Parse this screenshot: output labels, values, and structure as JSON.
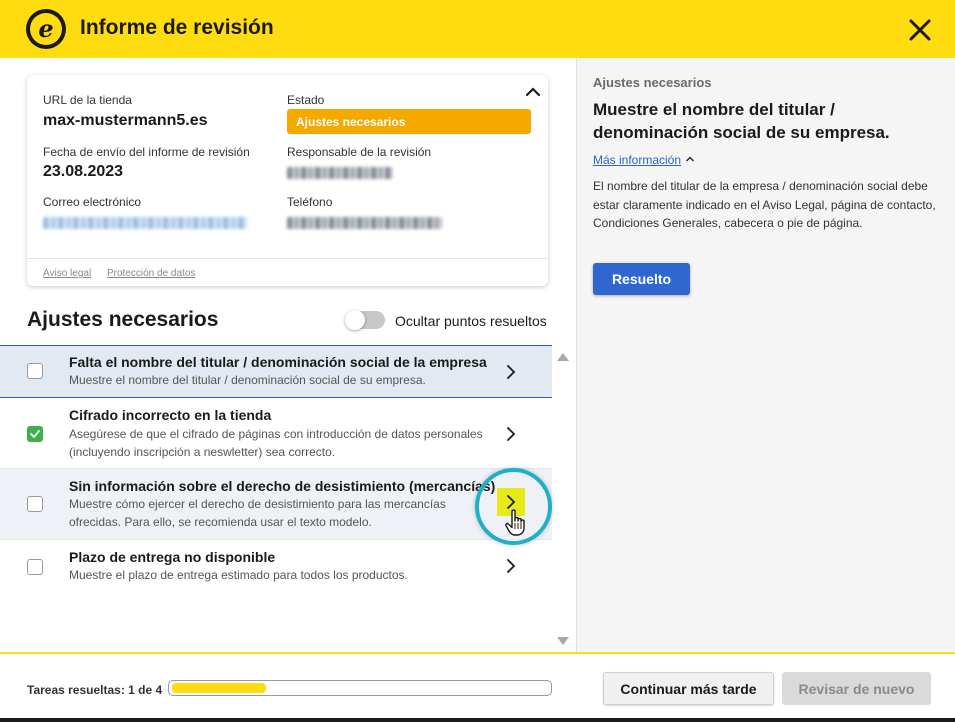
{
  "header": {
    "logo_letter": "e",
    "title": "Informe de revisión",
    "brand_color": "#ffdc0f",
    "close_icon": "close-icon"
  },
  "report_card": {
    "store_url_label": "URL de la tienda",
    "store_url": "max-mustermann5.es",
    "status_label": "Estado",
    "status_value": "Ajustes necesarios",
    "status_color": "#f5a800",
    "sent_date_label": "Fecha de envío del informe de revisión",
    "sent_date": "23.08.2023",
    "reviewer_label": "Responsable de la revisión",
    "email_label": "Correo electrónico",
    "phone_label": "Teléfono",
    "legal_link": "Aviso legal",
    "privacy_link": "Protección de datos"
  },
  "issues_section": {
    "title": "Ajustes necesarios",
    "hide_resolved_label": "Ocultar puntos resueltos",
    "hide_resolved_enabled": false
  },
  "issues": [
    {
      "title": "Falta el nombre del titular / denominación social de la empresa",
      "description": "Muestre el nombre del titular / denominación social de su empresa.",
      "resolved": false,
      "selected": true
    },
    {
      "title": "Cifrado incorrecto en la tienda",
      "description": "Asegúrese de que el cifrado de páginas con introducción de datos personales (incluyendo inscripción a neswletter) sea correcto.",
      "resolved": true,
      "selected": false
    },
    {
      "title": "Sin información sobre el derecho de desistimiento (mercancías)",
      "description": "Muestre cómo ejercer el derecho de desistimiento para las mercancías ofrecidas. Para ello, se recomienda usar el texto modelo.",
      "resolved": false,
      "selected": false
    },
    {
      "title": "Plazo de entrega no disponible",
      "description": "Muestre el plazo de entrega estimado para todos los productos.",
      "resolved": false,
      "selected": false
    }
  ],
  "detail_panel": {
    "label": "Ajustes necesarios",
    "heading": "Muestre el nombre del titular / denominación social de su empresa.",
    "more_info_link": "Más información",
    "body": "El nombre del titular de la empresa / denominación social debe estar claramente indicado en el Aviso Legal, página de contacto, Condiciones Generales, cabecera o pie de página.",
    "resolve_button": "Resuelto",
    "resolve_button_color": "#2f66cf"
  },
  "footer": {
    "tasks_label": "Tareas resueltas: 1 de 4",
    "progress_fraction": 0.25,
    "later_button": "Continuar más tarde",
    "recheck_button": "Revisar de nuevo"
  }
}
